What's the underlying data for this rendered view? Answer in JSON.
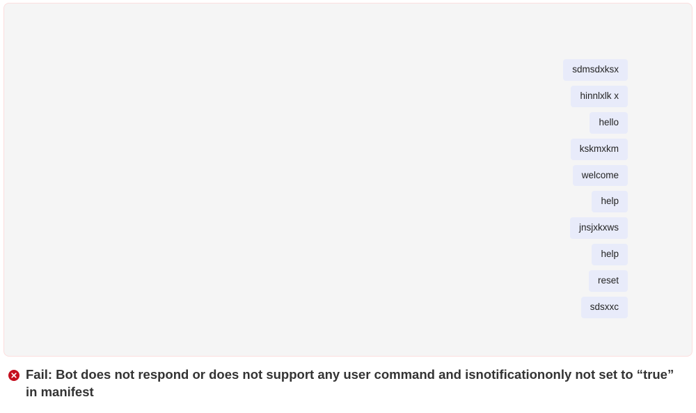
{
  "chat": {
    "messages": [
      "sdmsdxksx",
      "hinnlxlk x",
      "hello",
      "kskmxkm",
      "welcome",
      "help",
      "jnsjxkxws",
      "help",
      "reset",
      "sdsxxc"
    ]
  },
  "error": {
    "icon": "error-circle-icon",
    "text": "Fail: Bot does not respond or does not support any user command and isnotificationonly not set to “true” in manifest"
  },
  "colors": {
    "panel_bg": "#f5f5f5",
    "panel_border": "#fcdede",
    "bubble_bg": "#e8ebfa",
    "error_red": "#c50f1f"
  }
}
